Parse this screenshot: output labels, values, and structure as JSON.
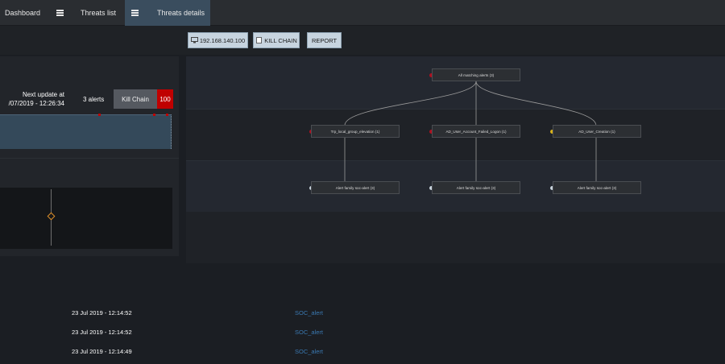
{
  "nav": {
    "tabs": [
      {
        "label": "Dashboard"
      },
      {
        "label": "Threats list"
      },
      {
        "label": "Threats details"
      }
    ]
  },
  "toolbar": {
    "ip_label": "192.168.140.100",
    "killchain_label": "KILL CHAIN",
    "report_label": "REPORT"
  },
  "summary": {
    "next_update_line1": "Next update at",
    "next_update_line2": "/07/2019 - 12:26:34",
    "alerts": "3 alerts",
    "killchain_label": "Kill Chain",
    "killchain_score": "100"
  },
  "graph": {
    "root": {
      "label": "All matching alerts (3)",
      "status": "red"
    },
    "level2": [
      {
        "label": "Trp_local_group_elevation (1)",
        "status": "red"
      },
      {
        "label": "AD_User_Account_Failed_Logon (1)",
        "status": "red"
      },
      {
        "label": "AD_User_Creation (1)",
        "status": "yellow"
      }
    ],
    "level3": [
      {
        "label": "Alert family soc-alert (3)",
        "status": "light"
      },
      {
        "label": "Alert family soc-alert (3)",
        "status": "light"
      },
      {
        "label": "Alert family soc-alert (3)",
        "status": "light"
      }
    ]
  },
  "colors": {
    "red": "#b01020",
    "yellow": "#d8b21a",
    "light": "#c9d4dd",
    "accent": "#3a4d5e",
    "link": "#3a78b0"
  },
  "alerts_list": [
    {
      "date": "23 Jul 2019 - 12:14:52",
      "type": "SOC_alert"
    },
    {
      "date": "23 Jul 2019 - 12:14:52",
      "type": "SOC_alert"
    },
    {
      "date": "23 Jul 2019 - 12:14:49",
      "type": "SOC_alert"
    }
  ]
}
